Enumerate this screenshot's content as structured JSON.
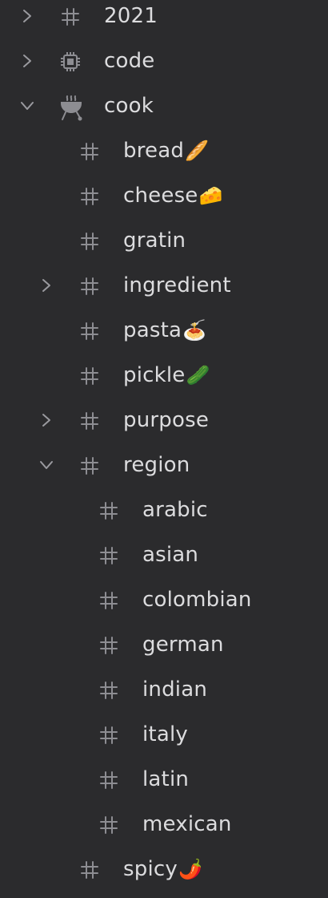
{
  "tree": {
    "items": [
      {
        "label": "2021",
        "emoji": ""
      },
      {
        "label": "code",
        "emoji": ""
      },
      {
        "label": "cook",
        "emoji": ""
      },
      {
        "label": "bread",
        "emoji": "🥖"
      },
      {
        "label": "cheese",
        "emoji": "🧀"
      },
      {
        "label": "gratin",
        "emoji": ""
      },
      {
        "label": "ingredient",
        "emoji": ""
      },
      {
        "label": "pasta",
        "emoji": "🍝"
      },
      {
        "label": "pickle",
        "emoji": "🥒"
      },
      {
        "label": "purpose",
        "emoji": ""
      },
      {
        "label": "region",
        "emoji": ""
      },
      {
        "label": "arabic",
        "emoji": ""
      },
      {
        "label": "asian",
        "emoji": ""
      },
      {
        "label": "colombian",
        "emoji": ""
      },
      {
        "label": "german",
        "emoji": ""
      },
      {
        "label": "indian",
        "emoji": ""
      },
      {
        "label": "italy",
        "emoji": ""
      },
      {
        "label": "latin",
        "emoji": ""
      },
      {
        "label": "mexican",
        "emoji": ""
      },
      {
        "label": "spicy",
        "emoji": "🌶️"
      }
    ]
  }
}
